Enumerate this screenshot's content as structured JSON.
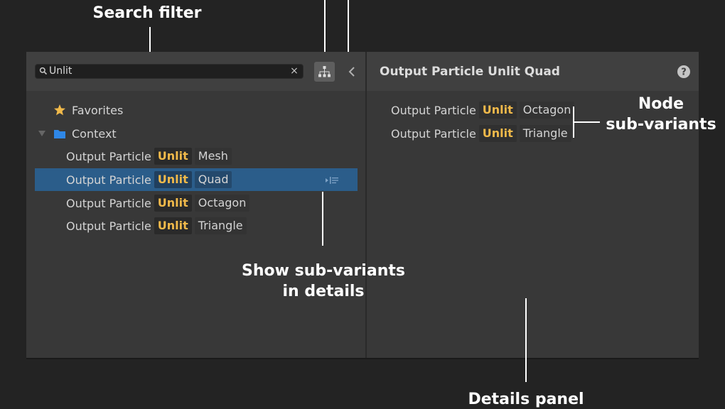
{
  "annotations": {
    "search_filter": "Search filter",
    "node_subvariants_line1": "Node",
    "node_subvariants_line2": "sub-variants",
    "show_subvariants_line1": "Show sub-variants",
    "show_subvariants_line2": "in details",
    "details_panel": "Details panel"
  },
  "search": {
    "value": "Unlit",
    "clear_glyph": "×",
    "icon": "search-icon"
  },
  "toolbar": {
    "hierarchy_icon": "hierarchy-icon",
    "collapse_icon": "chevron-left-icon"
  },
  "tree": {
    "favorites": {
      "label": "Favorites",
      "icon": "star-icon",
      "icon_color": "#f0b94a"
    },
    "context": {
      "label": "Context",
      "icon": "folder-icon",
      "icon_color": "#2f87e6",
      "expanded": true
    },
    "items": [
      {
        "prefix": "Output Particle",
        "highlight": "Unlit",
        "suffix": "Mesh",
        "selected": false
      },
      {
        "prefix": "Output Particle",
        "highlight": "Unlit",
        "suffix": "Quad",
        "selected": true
      },
      {
        "prefix": "Output Particle",
        "highlight": "Unlit",
        "suffix": "Octagon",
        "selected": false
      },
      {
        "prefix": "Output Particle",
        "highlight": "Unlit",
        "suffix": "Triangle",
        "selected": false
      }
    ]
  },
  "details": {
    "title": "Output Particle Unlit Quad",
    "help_icon": "help-icon",
    "subvariants": [
      {
        "prefix": "Output Particle",
        "highlight": "Unlit",
        "suffix": "Octagon"
      },
      {
        "prefix": "Output Particle",
        "highlight": "Unlit",
        "suffix": "Triangle"
      }
    ]
  },
  "colors": {
    "highlight_text": "#f0b94a",
    "selection": "#2b5d8a",
    "background": "#232323",
    "panel": "#383838"
  }
}
